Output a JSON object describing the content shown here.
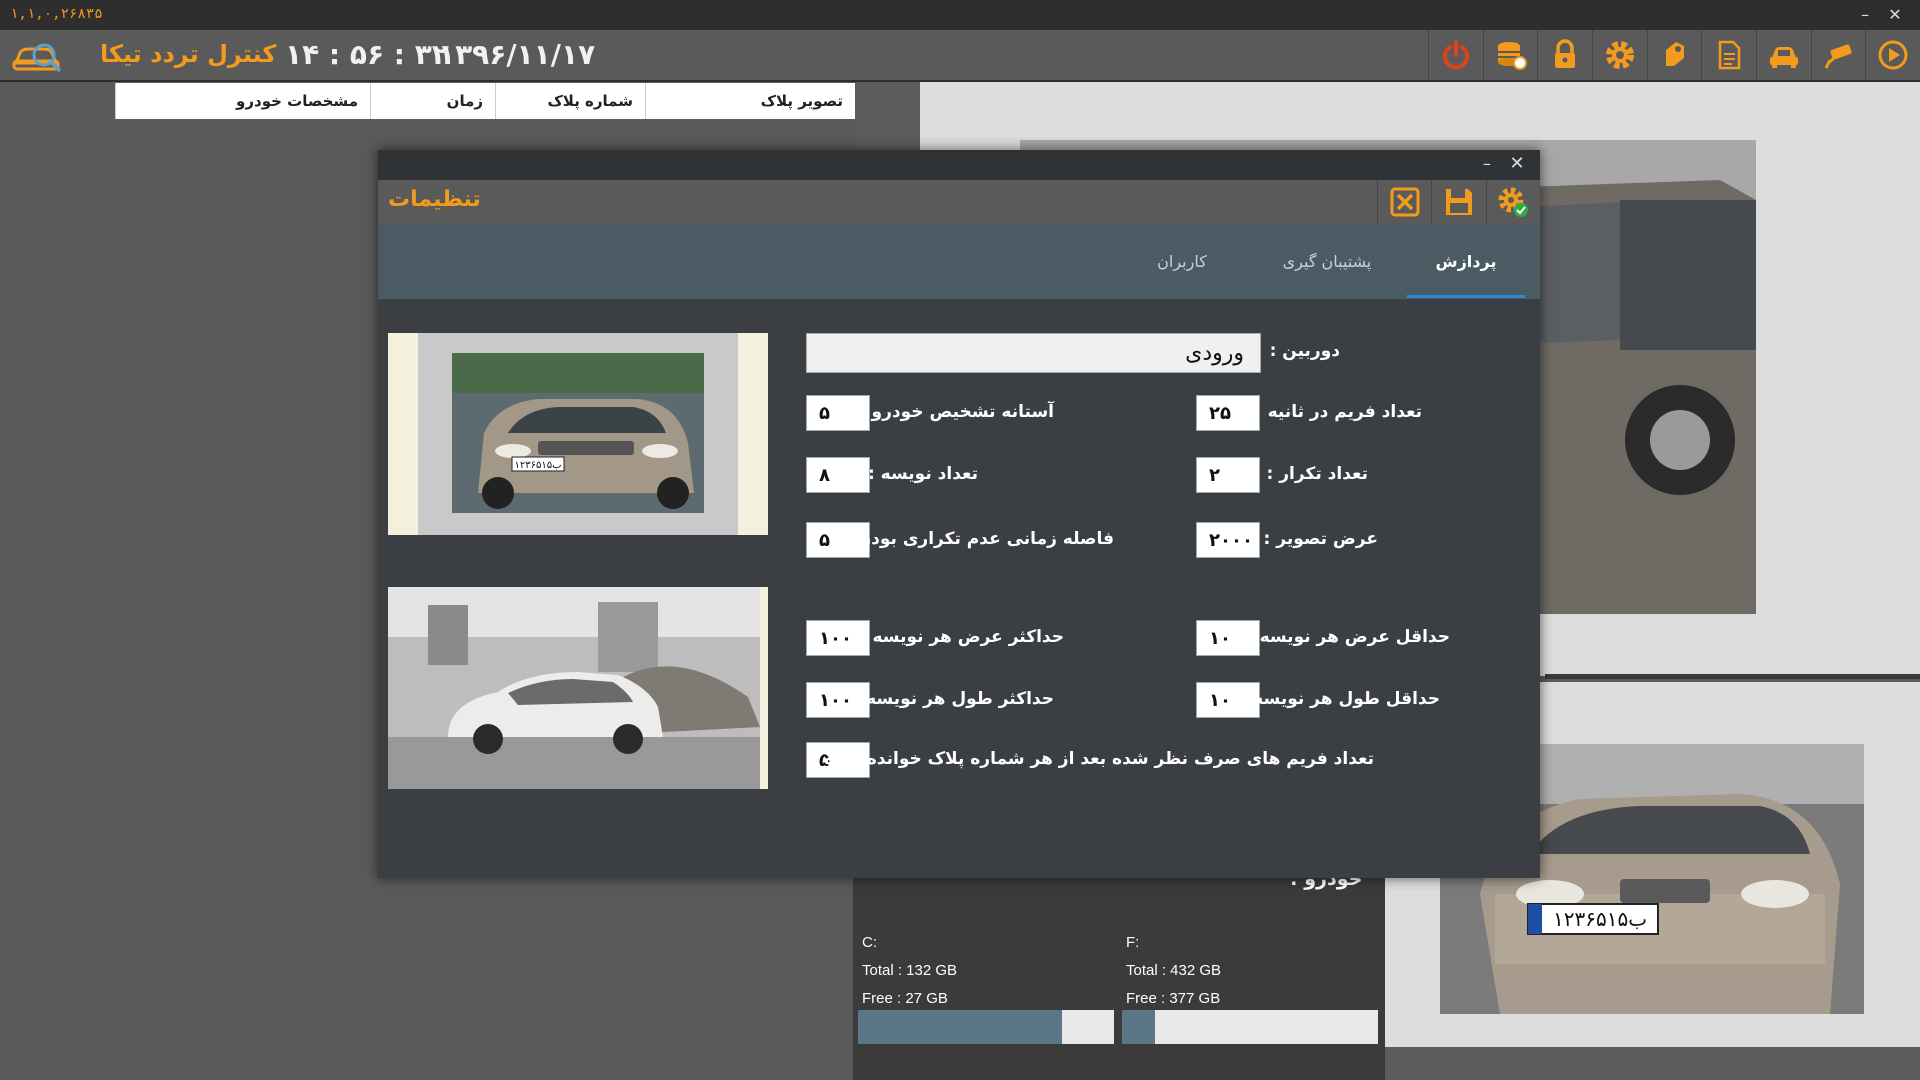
{
  "app": {
    "version": "۱,۱,۰,۲۶۸۳۵",
    "title": "کنترل تردد تیکا",
    "time": "۱۴ : ۵۶ : ۳۲",
    "date": "۱۳۹۶/۱۱/۱۷",
    "window_minimize": "–",
    "window_close": "✕"
  },
  "toolbar_icons": [
    "power-icon",
    "database-icon",
    "lock-icon",
    "gear-icon",
    "tag-icon",
    "report-icon",
    "car-icon",
    "camera-icon",
    "play-icon"
  ],
  "table": {
    "headers": [
      "تصویر پلاک",
      "شماره پلاک",
      "زمان",
      "مشخصات خودرو"
    ]
  },
  "info": {
    "vehicle_label": "خودرو :",
    "disks": [
      {
        "name": "C:",
        "total": "Total : 132 GB",
        "free": "Free : 27 GB",
        "used_fraction": 0.795
      },
      {
        "name": "F:",
        "total": "Total : 432 GB",
        "free": "Free : 377 GB",
        "used_fraction": 0.127
      }
    ]
  },
  "dialog": {
    "title": "تنظیمات",
    "minimize": "–",
    "close": "✕",
    "tabs": [
      {
        "label": "پردازش",
        "active": true
      },
      {
        "label": "پشتیبان گیری",
        "active": false
      },
      {
        "label": "کاربران",
        "active": false
      }
    ],
    "camera_label": "دوربین :",
    "camera_value": "ورودی",
    "fields": {
      "fps_label": "تعداد فریم در ثانیه",
      "fps_value": "۲۵",
      "vehicle_threshold_label": "آستانه تشخیص خودرو :",
      "vehicle_threshold_value": "۵",
      "repeat_label": "تعداد تکرار :",
      "repeat_value": "۲",
      "char_count_label": "تعداد نویسه :",
      "char_count_value": "۸",
      "image_width_label": "عرض تصویر :",
      "image_width_value": "۲۰۰۰",
      "non_repeat_interval_label": "فاصله زمانی عدم تکراری بودن :",
      "non_repeat_interval_value": "۵",
      "min_char_width_label": "حداقل عرض هر نویسه :",
      "min_char_width_value": "۱۰",
      "max_char_width_label": "حداکثر عرض هر نویسه :",
      "max_char_width_value": "۱۰۰",
      "min_char_height_label": "حداقل طول هر نویسه :",
      "min_char_height_value": "۱۰",
      "max_char_height_label": "حداکثر طول هر نویسه :",
      "max_char_height_value": "۱۰۰",
      "skipped_frames_label": "تعداد فریم های صرف نظر شده بعد از هر شماره پلاک خوانده شده :",
      "skipped_frames_value": "۵"
    }
  },
  "plates": {
    "top_thumb": "۱۲ب۳۶۵۱۵",
    "right_big": "۱۲ب۳۶۵۱۵"
  },
  "colors": {
    "accent": "#f29b1d",
    "tab_bar": "#4b5b64",
    "tab_active_underline": "#2c8bd8",
    "disk_fill": "#5b7684"
  }
}
